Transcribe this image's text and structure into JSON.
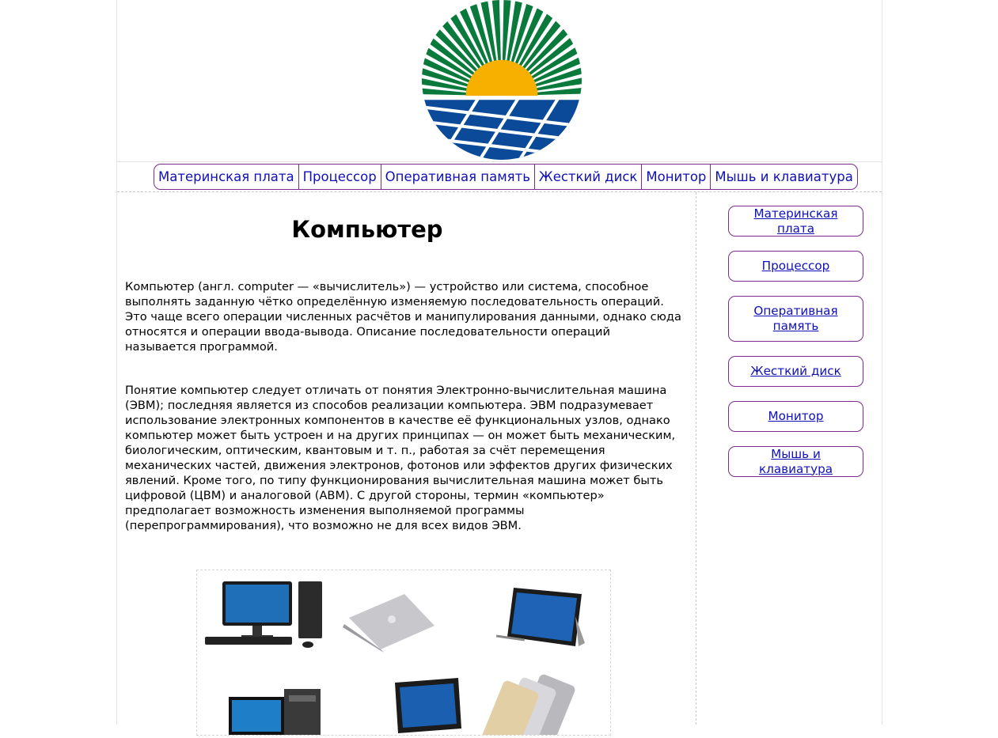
{
  "logo": {
    "name": "sun-over-solar-panels-logo"
  },
  "topnav": [
    {
      "label": "Материнская плата"
    },
    {
      "label": "Процессор"
    },
    {
      "label": "Оперативная память"
    },
    {
      "label": "Жесткий диск"
    },
    {
      "label": "Монитор"
    },
    {
      "label": "Мышь и клавиатура"
    }
  ],
  "main": {
    "title": "Компьютер",
    "paragraphs": [
      "Компьютер (англ. computer — «вычислитель») — устройство или система, способное выполнять заданную чётко определённую изменяемую последовательность операций. Это чаще всего операции численных расчётов и манипулирования данными, однако сюда относятся и операции ввода-вывода. Описание последовательности операций называется программой.",
      "Понятие компьютер следует отличать от понятия Электронно-вычислительная машина (ЭВМ); последняя является из способов реализации компьютера. ЭВМ подразумевает использование электронных компонентов в качестве её функциональных узлов, однако компьютер может быть устроен и на других принципах — он может быть механическим, биологическим, оптическим, квантовым и т. п., работая за счёт перемещения механических частей, движения электронов, фотонов или эффектов других физических явлений. Кроме того, по типу функционирования вычислительная машина может быть цифровой (ЦВМ) и аналоговой (АВМ). С другой стороны, термин «компьютер» предполагает возможность изменения выполняемой программы (перепрограммирования), что возможно не для всех видов ЭВМ."
    ],
    "gallery": [
      "desktop-pc-image",
      "laptop-image",
      "tablet-with-stand-image",
      "pc-tower-monitor-image",
      "tablet-keyboard-image",
      "smartphones-image"
    ]
  },
  "sidebar": [
    {
      "label": "Материнская плата"
    },
    {
      "label": "Процессор"
    },
    {
      "label": "Оперативная память"
    },
    {
      "label": "Жесткий диск"
    },
    {
      "label": "Монитор"
    },
    {
      "label": "Мышь и клавиатура"
    }
  ],
  "colors": {
    "link": "#1010b8",
    "border": "#7b2c8e",
    "logo_green": "#0a7a3c",
    "logo_sun": "#f7b000",
    "logo_blue": "#0b4a99"
  }
}
